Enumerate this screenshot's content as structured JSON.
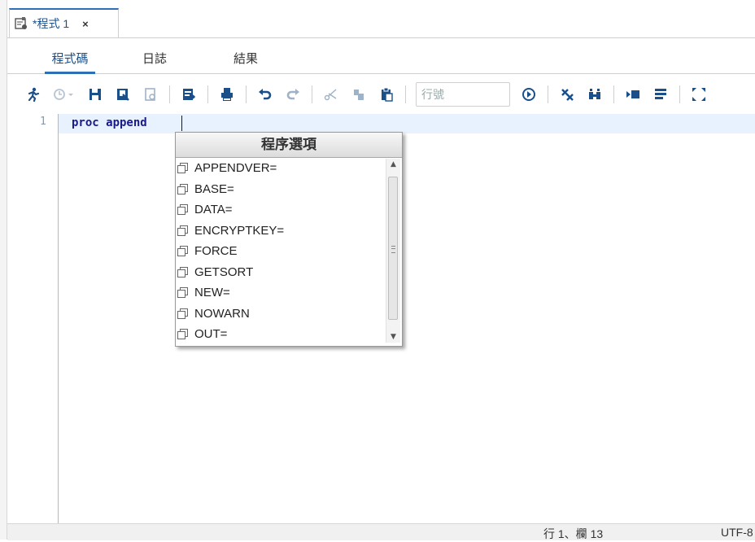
{
  "document_tab": {
    "title": "*程式 1",
    "close_glyph": "×"
  },
  "subtabs": [
    {
      "label": "程式碼",
      "active": true
    },
    {
      "label": "日誌",
      "active": false
    },
    {
      "label": "結果",
      "active": false
    }
  ],
  "toolbar": {
    "line_number_placeholder": "行號",
    "icons": [
      "run-icon",
      "history-icon",
      "save-icon",
      "save-as-icon",
      "print-preview-icon",
      "export-icon",
      "print-icon",
      "undo-icon",
      "redo-icon",
      "cut-icon",
      "copy-icon",
      "paste-icon",
      "goto-line-icon",
      "clear-icon",
      "find-replace-icon",
      "format-code-icon",
      "collapse-icon",
      "expand-icon"
    ]
  },
  "editor": {
    "line_numbers": [
      "1"
    ],
    "code_line": "proc append"
  },
  "autocomplete": {
    "title": "程序選項",
    "options": [
      "APPENDVER=",
      "BASE=",
      "DATA=",
      "ENCRYPTKEY=",
      "FORCE",
      "GETSORT",
      "NEW=",
      "NOWARN",
      "OUT="
    ]
  },
  "statusbar": {
    "position": "行 1、欄 13",
    "encoding": "UTF-8"
  },
  "colors": {
    "accent": "#2f6fb4",
    "code_keyword": "#1a1a8a",
    "current_line": "#e8f2fe"
  }
}
